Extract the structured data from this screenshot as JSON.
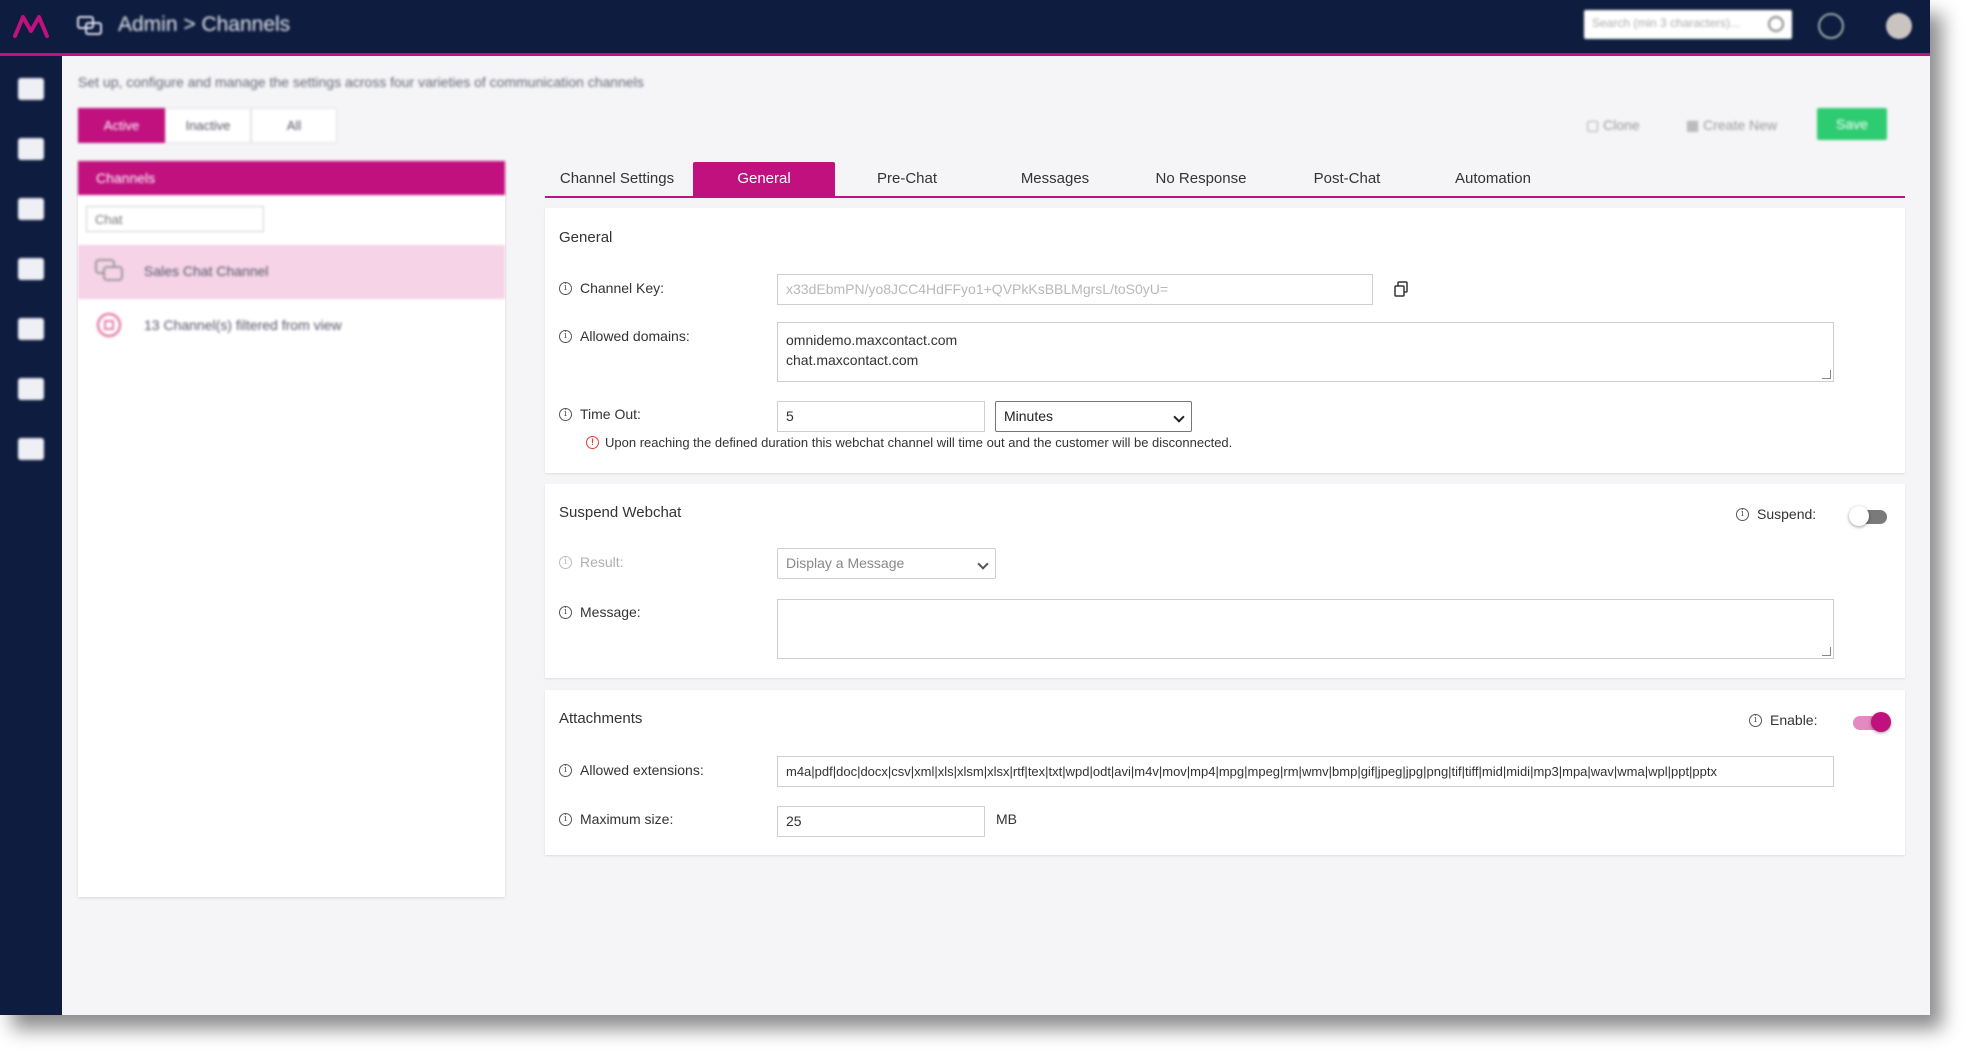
{
  "header": {
    "breadcrumb": "Admin > Channels",
    "search_placeholder": "Search (min 3 characters)..."
  },
  "page": {
    "description": "Set up, configure and manage the settings across four varieties of communication channels",
    "filters": [
      "Active",
      "Inactive",
      "All"
    ],
    "toolbar": {
      "clone": "Clone",
      "create_new": "Create New",
      "save": "Save"
    }
  },
  "channels_panel": {
    "title": "Channels",
    "type_select": "Chat",
    "selected_channel": "Sales Chat Channel",
    "filtered_note": "13 Channel(s) filtered from view"
  },
  "tabs": [
    "Channel Settings",
    "General",
    "Pre-Chat",
    "Messages",
    "No Response",
    "Post-Chat",
    "Automation"
  ],
  "general": {
    "title": "General",
    "channel_key_label": "Channel Key:",
    "channel_key_value": "x33dEbmPN/yo8JCC4HdFFyo1+QVPkKsBBLMgrsL/toS0yU=",
    "allowed_domains_label": "Allowed domains:",
    "allowed_domains": [
      "omnidemo.maxcontact.com",
      "chat.maxcontact.com"
    ],
    "timeout_label": "Time Out:",
    "timeout_value": "5",
    "timeout_unit": "Minutes",
    "timeout_warning": "Upon reaching the defined duration this webchat channel will time out and the customer will be disconnected."
  },
  "suspend": {
    "title": "Suspend Webchat",
    "suspend_label": "Suspend:",
    "suspend_on": false,
    "result_label": "Result:",
    "result_value": "Display a Message",
    "message_label": "Message:",
    "message_value": ""
  },
  "attachments": {
    "title": "Attachments",
    "enable_label": "Enable:",
    "enabled": true,
    "extensions_label": "Allowed extensions:",
    "extensions_value": "m4a|pdf|doc|docx|csv|xml|xls|xlsm|xlsx|rtf|tex|txt|wpd|odt|avi|m4v|mov|mp4|mpg|mpeg|rm|wmv|bmp|gif|jpeg|jpg|png|tif|tiff|mid|midi|mp3|mpa|wav|wma|wpl|ppt|pptx",
    "max_size_label": "Maximum size:",
    "max_size_value": "25",
    "max_size_unit": "MB"
  },
  "colors": {
    "brand": "#c0117e",
    "nav": "#0e1c3f",
    "save": "#2ecc71"
  }
}
